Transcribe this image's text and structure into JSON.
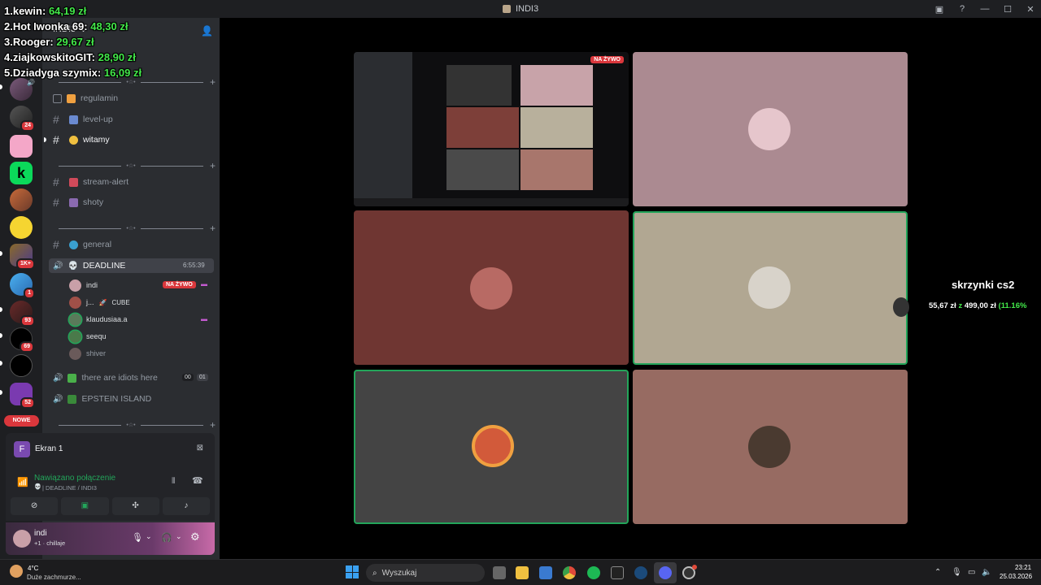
{
  "window": {
    "title": "INDI3"
  },
  "leaderboard": [
    {
      "rank": "1.",
      "name": "kewin:",
      "amount": "64,19 zł"
    },
    {
      "rank": "2.",
      "name": "Hot Iwonka 69:",
      "amount": "48,30 zł"
    },
    {
      "rank": "3.",
      "name": "Rooger:",
      "amount": "29,67 zł"
    },
    {
      "rank": "4.",
      "name": "ziajkowskitoGIT:",
      "amount": "28,90 zł"
    },
    {
      "rank": "5.",
      "name": "Dziadyga szymix:",
      "amount": "16,09 zł"
    }
  ],
  "server_badges": {
    "s1": "24",
    "s2": "1K+",
    "s3": "1",
    "s4": "93",
    "s5": "69",
    "s6": "52",
    "nowe": "NOWE"
  },
  "server": {
    "name": "INDI3"
  },
  "channels": {
    "regulamin": "regulamin",
    "level_up": "level-up",
    "witamy": "witamy",
    "stream_alert": "stream-alert",
    "shoty": "shoty",
    "general": "general",
    "deadline": "DEADLINE",
    "deadline_timer": "6:55:39",
    "idiots": "there are idiots here",
    "idiots_count_a": "00",
    "idiots_count_b": "01",
    "epstein": "EPSTEIN ISLAND"
  },
  "voice_users": [
    {
      "name": "indi",
      "live": "NA ŻYWO"
    },
    {
      "name": "j...",
      "tag": "CUBE"
    },
    {
      "name": "klaudusiaa.a"
    },
    {
      "name": "seequ"
    },
    {
      "name": "shiver"
    }
  ],
  "screen_panel": {
    "avatar_letter": "F",
    "label": "Ekran 1"
  },
  "connection": {
    "status": "Nawiązano połączenie",
    "path": "| DEADLINE / INDI3"
  },
  "user": {
    "name": "indi",
    "status": "+1 · chillaje"
  },
  "stream": {
    "live_badge": "NA ŻYWO"
  },
  "overlay": {
    "title": "skrzynki cs2",
    "progress_current": "55,67 zł",
    "progress_sep": "z",
    "progress_goal": "499,00 zł",
    "progress_percent": "(11.16%"
  },
  "taskbar": {
    "weather_temp": "4°C",
    "weather_desc": "Duże zachmurze...",
    "search_placeholder": "Wyszukaj",
    "time": "23:21",
    "date": "25.03.2026"
  },
  "colors": {
    "live_red": "#da373c",
    "speaking_green": "#23a55a",
    "money_green": "#43e94a"
  }
}
